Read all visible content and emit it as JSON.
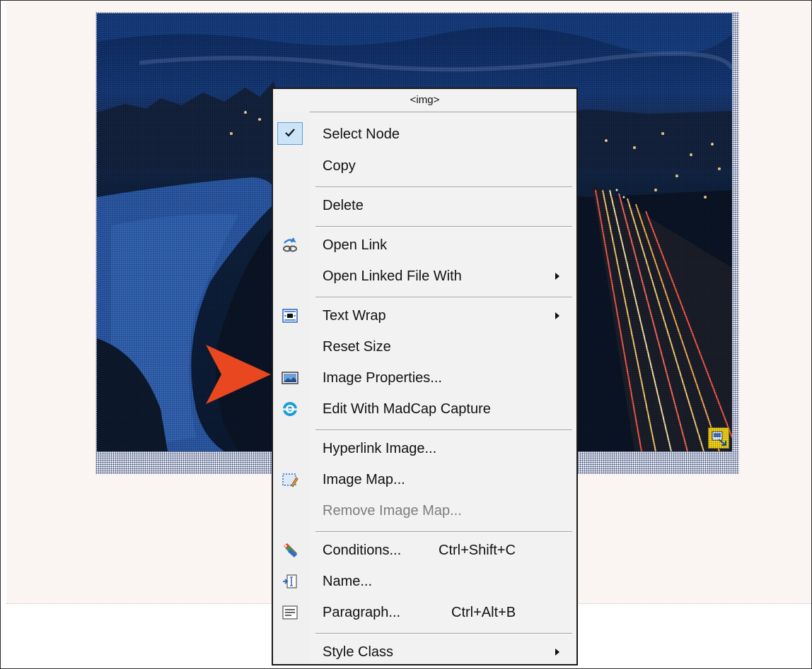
{
  "menu": {
    "title": "<img>",
    "items": {
      "select_node": "Select Node",
      "copy": "Copy",
      "delete": "Delete",
      "open_link": "Open Link",
      "open_linked_file_with": "Open Linked File With",
      "text_wrap": "Text Wrap",
      "reset_size": "Reset Size",
      "image_properties": "Image Properties...",
      "edit_with_madcap_capture": "Edit With MadCap Capture",
      "hyperlink_image": "Hyperlink Image...",
      "image_map": "Image Map...",
      "remove_image_map": "Remove Image Map...",
      "conditions": "Conditions...",
      "conditions_shortcut": "Ctrl+Shift+C",
      "name": "Name...",
      "paragraph": "Paragraph...",
      "paragraph_shortcut": "Ctrl+Alt+B",
      "style_class": "Style Class"
    },
    "checked_item": "Select Node",
    "disabled_items": [
      "Remove Image Map..."
    ],
    "submenu_items": [
      "Open Linked File With",
      "Text Wrap",
      "Style Class"
    ]
  },
  "icons": {
    "select_node": "checkmark-icon",
    "open_link": "chain-link-arrow-icon",
    "text_wrap": "text-wrap-icon",
    "image_properties": "image-properties-icon",
    "edit_with_madcap_capture": "madcap-capture-icon",
    "image_map": "image-map-icon",
    "conditions": "conditions-tag-icon",
    "name": "name-field-icon",
    "paragraph": "paragraph-icon",
    "resize_handle": "image-resize-icon"
  },
  "colors": {
    "pointer_arrow": "#e8471f",
    "resize_handle": "#f3d418",
    "check_highlight": "#cce4f7"
  }
}
